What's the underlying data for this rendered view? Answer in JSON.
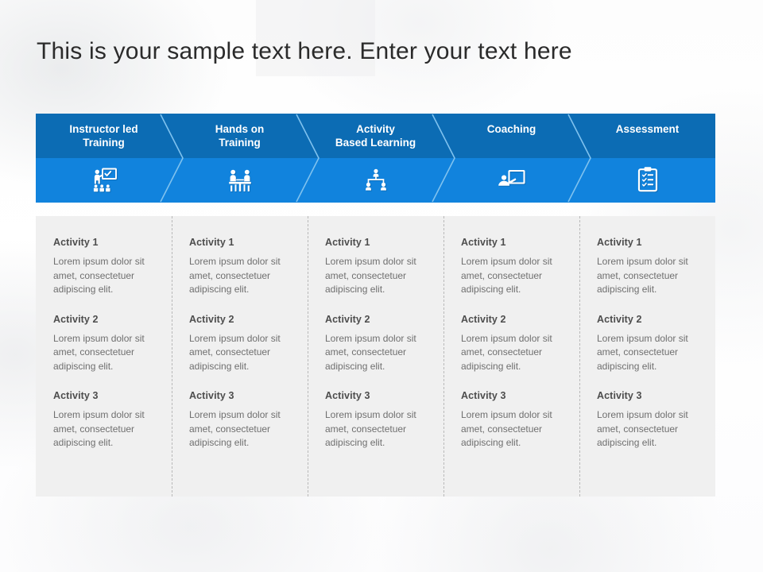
{
  "slide": {
    "title": "This is your sample text here. Enter your text here",
    "accent_dark": "#0c6cb4",
    "accent_light": "#1183dd",
    "panel_bg": "#f0f0f0",
    "divider_color": "#b9b9b9"
  },
  "process": {
    "steps": [
      {
        "label": "Instructor led\nTraining",
        "icon": "instructor-led-training-icon"
      },
      {
        "label": "Hands on\nTraining",
        "icon": "hands-on-training-icon"
      },
      {
        "label": "Activity\nBased Learning",
        "icon": "activity-based-learning-icon"
      },
      {
        "label": "Coaching",
        "icon": "coaching-icon"
      },
      {
        "label": "Assessment",
        "icon": "assessment-icon"
      }
    ]
  },
  "columns": [
    {
      "activities": [
        {
          "title": "Activity 1",
          "body": "Lorem ipsum dolor sit amet, consectetuer adipiscing elit."
        },
        {
          "title": "Activity 2",
          "body": "Lorem ipsum dolor sit amet, consectetuer adipiscing elit."
        },
        {
          "title": "Activity 3",
          "body": "Lorem ipsum dolor sit amet, consectetuer adipiscing elit."
        }
      ]
    },
    {
      "activities": [
        {
          "title": "Activity 1",
          "body": "Lorem ipsum dolor sit amet, consectetuer adipiscing elit."
        },
        {
          "title": "Activity 2",
          "body": "Lorem ipsum dolor sit amet, consectetuer adipiscing elit."
        },
        {
          "title": "Activity 3",
          "body": "Lorem ipsum dolor sit amet, consectetuer adipiscing elit."
        }
      ]
    },
    {
      "activities": [
        {
          "title": "Activity 1",
          "body": "Lorem ipsum dolor sit amet, consectetuer adipiscing elit."
        },
        {
          "title": "Activity 2",
          "body": "Lorem ipsum dolor sit amet, consectetuer adipiscing elit."
        },
        {
          "title": "Activity 3",
          "body": "Lorem ipsum dolor sit amet, consectetuer adipiscing elit."
        }
      ]
    },
    {
      "activities": [
        {
          "title": "Activity 1",
          "body": "Lorem ipsum dolor sit amet, consectetuer adipiscing elit."
        },
        {
          "title": "Activity 2",
          "body": "Lorem ipsum dolor sit amet, consectetuer adipiscing elit."
        },
        {
          "title": "Activity 3",
          "body": "Lorem ipsum dolor sit amet, consectetuer adipiscing elit."
        }
      ]
    },
    {
      "activities": [
        {
          "title": "Activity 1",
          "body": "Lorem ipsum dolor sit amet, consectetuer adipiscing elit."
        },
        {
          "title": "Activity 2",
          "body": "Lorem ipsum dolor sit amet, consectetuer adipiscing elit."
        },
        {
          "title": "Activity 3",
          "body": "Lorem ipsum dolor sit amet, consectetuer adipiscing elit."
        }
      ]
    }
  ]
}
